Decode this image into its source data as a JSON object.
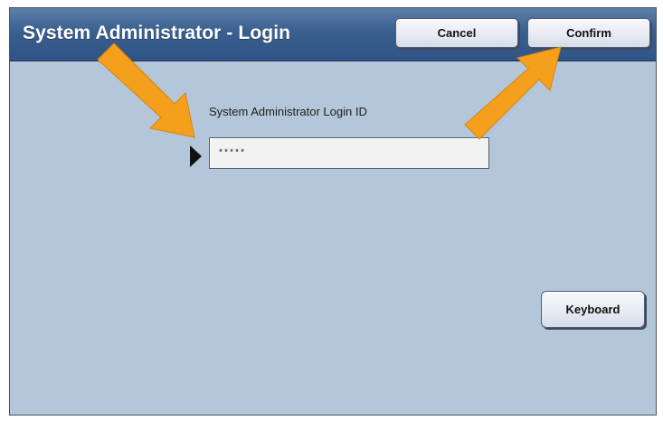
{
  "window": {
    "title": "System Administrator - Login"
  },
  "toolbar": {
    "cancel_label": "Cancel",
    "confirm_label": "Confirm"
  },
  "form": {
    "login_id_label": "System Administrator Login ID",
    "login_id_value": "*****"
  },
  "actions": {
    "keyboard_label": "Keyboard"
  },
  "colors": {
    "screen_background": "#b4c6da",
    "title_bar": "#3a5f8f",
    "annotation_arrow": "#f5a01c"
  }
}
